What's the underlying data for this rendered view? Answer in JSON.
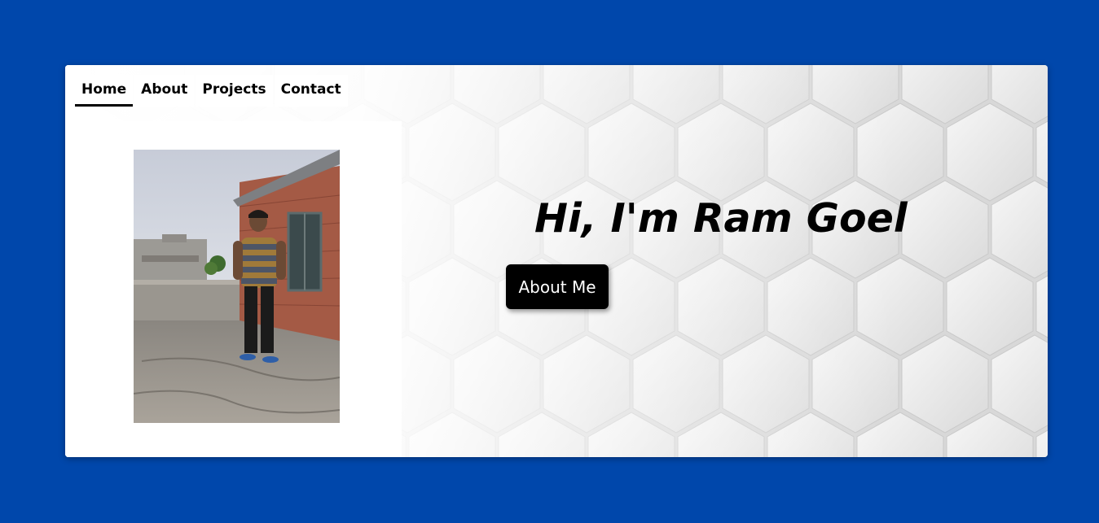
{
  "nav": {
    "items": [
      {
        "label": "Home",
        "active": true
      },
      {
        "label": "About",
        "active": false
      },
      {
        "label": "Projects",
        "active": false
      },
      {
        "label": "Contact",
        "active": false
      }
    ]
  },
  "hero": {
    "title": "Hi, I'm Ram Goel",
    "button_label": "About Me"
  },
  "colors": {
    "page_background": "#0047AB",
    "button_background": "#000000",
    "button_text": "#FFFFFF"
  },
  "images": {
    "profile_photo": "profile-photo-man-standing-on-rooftop"
  }
}
